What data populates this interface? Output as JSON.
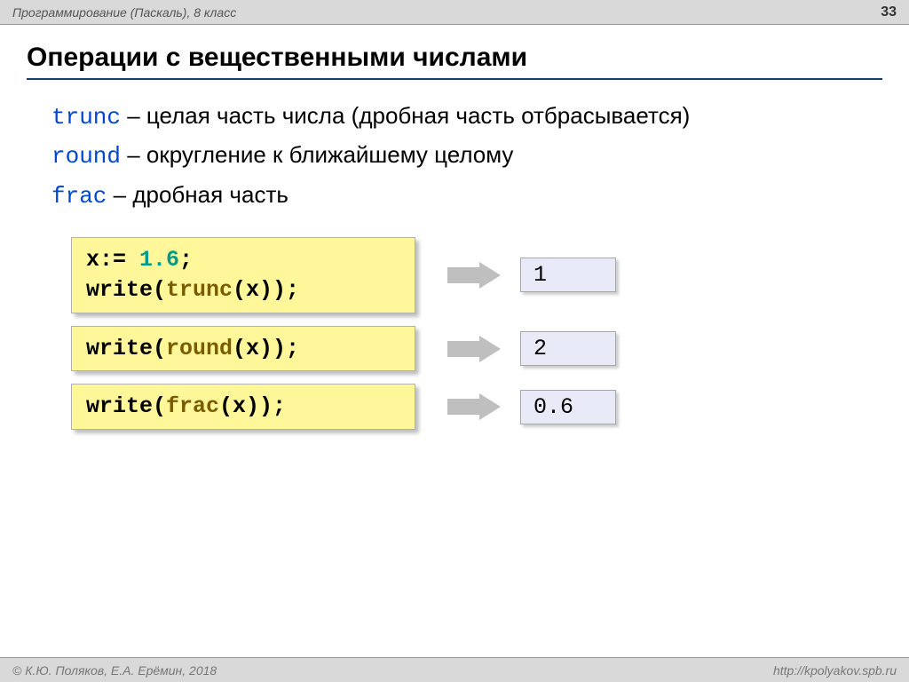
{
  "header": {
    "title": "Программирование (Паскаль), 8 класс",
    "page": "33"
  },
  "title": "Операции с вещественными числами",
  "defs": {
    "trunc": {
      "kw": "trunc",
      "text": " – целая часть числа (дробная часть отбрасывается)"
    },
    "round": {
      "kw": "round",
      "text": " – округление к ближайшему целому"
    },
    "frac": {
      "kw": "frac",
      "text": " – дробная часть"
    }
  },
  "examples": {
    "r1": {
      "line1a": "x:= ",
      "num": "1.6",
      "line1b": ";",
      "line2a": "write(",
      "fn": "trunc",
      "line2b": "(x));",
      "result": "1"
    },
    "r2": {
      "linea": "write(",
      "fn": "round",
      "lineb": "(x));",
      "result": "2"
    },
    "r3": {
      "linea": "write(",
      "fn": "frac",
      "lineb": "(x));",
      "result": "0.6"
    }
  },
  "footer": {
    "left": "© К.Ю. Поляков, Е.А. Ерёмин, 2018",
    "right": "http://kpolyakov.spb.ru"
  }
}
